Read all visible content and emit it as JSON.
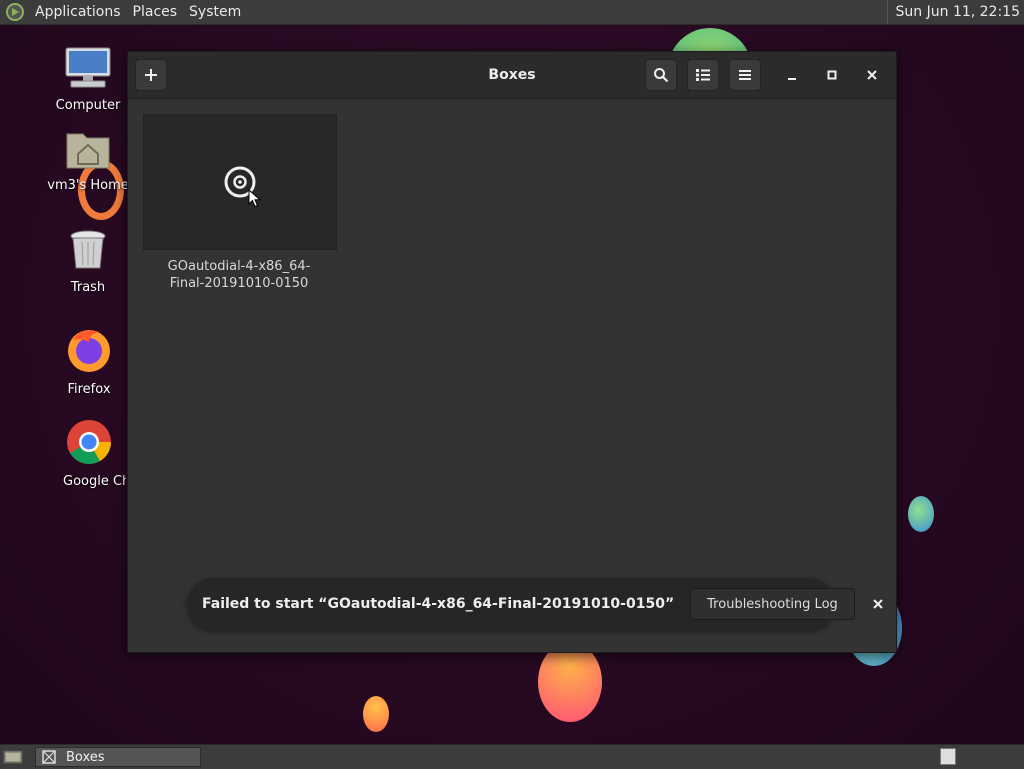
{
  "top_panel": {
    "menus": [
      "Applications",
      "Places",
      "System"
    ],
    "clock": "Sun Jun 11, 22:15"
  },
  "desktop": {
    "icons": [
      {
        "label": "Computer",
        "icon": "computer-icon"
      },
      {
        "label": "vm3's Home",
        "icon": "home-folder-icon"
      },
      {
        "label": "Trash",
        "icon": "trash-icon"
      },
      {
        "label": "Firefox",
        "icon": "firefox-icon"
      },
      {
        "label": "Google Ch",
        "icon": "chrome-icon"
      }
    ]
  },
  "window": {
    "title": "Boxes",
    "buttons": {
      "new": "plus-icon",
      "search": "search-icon",
      "view": "list-view-icon",
      "menu": "hamburger-menu-icon",
      "minimize": "minimize-icon",
      "maximize": "maximize-icon",
      "close": "close-icon"
    },
    "boxes": [
      {
        "name": "GOautodial-4-x86_64-Final-20191010-0150",
        "name_line1": "GOautodial-4-x86_64-",
        "name_line2": "Final-20191010-0150",
        "state_icon": "target-icon"
      }
    ],
    "notification": {
      "message": "Failed to start “GOautodial-4-x86_64-Final-20191010-0150”",
      "button": "Troubleshooting Log"
    }
  },
  "bottom_panel": {
    "task": "Boxes"
  },
  "colors": {
    "wallpaper": "#2a0a24",
    "window_bg": "#333333",
    "headerbar": "#2b2b2b",
    "panel": "#3c3c3c"
  }
}
